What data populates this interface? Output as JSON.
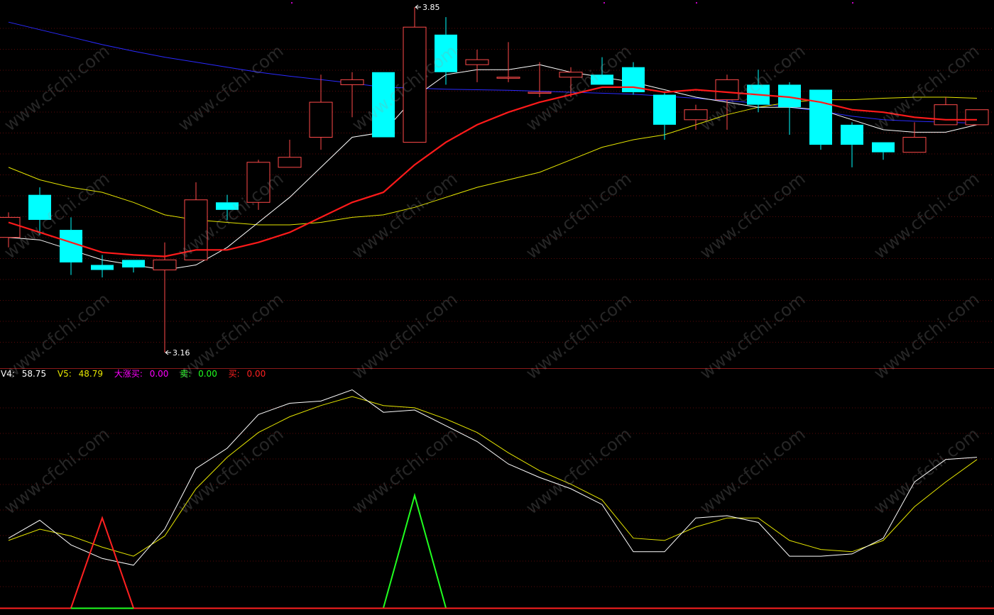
{
  "watermark": "www.cfchi.com",
  "colors": {
    "background": "#000000",
    "grid": "#5a0a0a",
    "separator": "#8b1a1a",
    "up_candle": "#ff4a4a",
    "down_candle": "#00ffff",
    "ma_white": "#ffffff",
    "ma_red": "#ff1a1a",
    "ma_yellow": "#e6e600",
    "ma_blue": "#2a2aff",
    "v4_line": "#ffffff",
    "v5_line": "#e6e600",
    "buy_line": "#ff2020",
    "sell_line": "#20ff20",
    "big_rise_line": "#ff00ff"
  },
  "legend": {
    "v4_label": "V4:",
    "v4_value": "58.75",
    "v5_label": "V5:",
    "v5_value": "48.79",
    "big_rise_label": "大涨买:",
    "big_rise_value": "0.00",
    "sell_label": "卖:",
    "sell_value": "0.00",
    "buy_label": "买:",
    "buy_value": "0.00"
  },
  "chart_data": [
    {
      "type": "candlestick",
      "title": "",
      "ylim": [
        3.14,
        3.86
      ],
      "annotations": [
        {
          "text": "3.85",
          "index": 13,
          "value": 3.85
        },
        {
          "text": "3.16",
          "index": 5,
          "value": 3.16
        }
      ],
      "candles": [
        {
          "open": 3.39,
          "close": 3.43,
          "high": 3.44,
          "low": 3.37
        },
        {
          "open": 3.475,
          "close": 3.425,
          "high": 3.49,
          "low": 3.395
        },
        {
          "open": 3.405,
          "close": 3.34,
          "high": 3.43,
          "low": 3.315
        },
        {
          "open": 3.335,
          "close": 3.325,
          "high": 3.355,
          "low": 3.31
        },
        {
          "open": 3.345,
          "close": 3.33,
          "high": 3.345,
          "low": 3.32
        },
        {
          "open": 3.325,
          "close": 3.345,
          "high": 3.38,
          "low": 3.16
        },
        {
          "open": 3.345,
          "close": 3.465,
          "high": 3.5,
          "low": 3.345
        },
        {
          "open": 3.46,
          "close": 3.445,
          "high": 3.475,
          "low": 3.425
        },
        {
          "open": 3.46,
          "close": 3.54,
          "high": 3.545,
          "low": 3.445
        },
        {
          "open": 3.53,
          "close": 3.55,
          "high": 3.585,
          "low": 3.53
        },
        {
          "open": 3.59,
          "close": 3.66,
          "high": 3.715,
          "low": 3.565
        },
        {
          "open": 3.695,
          "close": 3.705,
          "high": 3.72,
          "low": 3.63
        },
        {
          "open": 3.72,
          "close": 3.59,
          "high": 3.72,
          "low": 3.59
        },
        {
          "open": 3.58,
          "close": 3.81,
          "high": 3.85,
          "low": 3.58
        },
        {
          "open": 3.795,
          "close": 3.72,
          "high": 3.83,
          "low": 3.695
        },
        {
          "open": 3.735,
          "close": 3.745,
          "high": 3.765,
          "low": 3.7
        },
        {
          "open": 3.71,
          "close": 3.71,
          "high": 3.78,
          "low": 3.7
        },
        {
          "open": 3.68,
          "close": 3.68,
          "high": 3.74,
          "low": 3.67
        },
        {
          "open": 3.71,
          "close": 3.72,
          "high": 3.73,
          "low": 3.67
        },
        {
          "open": 3.715,
          "close": 3.695,
          "high": 3.75,
          "low": 3.695
        },
        {
          "open": 3.73,
          "close": 3.68,
          "high": 3.74,
          "low": 3.675
        },
        {
          "open": 3.675,
          "close": 3.615,
          "high": 3.68,
          "low": 3.585
        },
        {
          "open": 3.625,
          "close": 3.645,
          "high": 3.655,
          "low": 3.605
        },
        {
          "open": 3.665,
          "close": 3.705,
          "high": 3.715,
          "low": 3.605
        },
        {
          "open": 3.695,
          "close": 3.655,
          "high": 3.725,
          "low": 3.64
        },
        {
          "open": 3.695,
          "close": 3.65,
          "high": 3.7,
          "low": 3.595
        },
        {
          "open": 3.685,
          "close": 3.575,
          "high": 3.685,
          "low": 3.565
        },
        {
          "open": 3.615,
          "close": 3.575,
          "high": 3.62,
          "low": 3.53
        },
        {
          "open": 3.58,
          "close": 3.56,
          "high": 3.58,
          "low": 3.545
        },
        {
          "open": 3.56,
          "close": 3.59,
          "high": 3.62,
          "low": 3.56
        },
        {
          "open": 3.615,
          "close": 3.655,
          "high": 3.67,
          "low": 3.615
        },
        {
          "open": 3.615,
          "close": 3.645,
          "high": 3.645,
          "low": 3.615
        }
      ],
      "series": [
        {
          "color": "#ffffff",
          "values": [
            3.39,
            3.385,
            3.365,
            3.345,
            3.335,
            3.325,
            3.335,
            3.37,
            3.42,
            3.47,
            3.53,
            3.59,
            3.6,
            3.67,
            3.715,
            3.725,
            3.725,
            3.735,
            3.72,
            3.71,
            3.7,
            3.685,
            3.67,
            3.66,
            3.65,
            3.65,
            3.645,
            3.625,
            3.605,
            3.6,
            3.6,
            3.615
          ]
        },
        {
          "color": "#ff1a1a",
          "values": [
            3.42,
            3.4,
            3.38,
            3.36,
            3.355,
            3.352,
            3.365,
            3.365,
            3.38,
            3.4,
            3.43,
            3.46,
            3.48,
            3.535,
            3.58,
            3.615,
            3.64,
            3.66,
            3.675,
            3.69,
            3.69,
            3.68,
            3.685,
            3.68,
            3.675,
            3.67,
            3.66,
            3.645,
            3.64,
            3.63,
            3.625,
            3.625
          ]
        },
        {
          "color": "#e6e600",
          "values": [
            3.53,
            3.505,
            3.49,
            3.48,
            3.46,
            3.435,
            3.425,
            3.42,
            3.415,
            3.415,
            3.42,
            3.43,
            3.435,
            3.45,
            3.47,
            3.49,
            3.505,
            3.52,
            3.545,
            3.57,
            3.585,
            3.595,
            3.615,
            3.635,
            3.65,
            3.66,
            3.665,
            3.665,
            3.668,
            3.67,
            3.67,
            3.668
          ]
        },
        {
          "color": "#2a2aff",
          "values": [
            3.82,
            3.805,
            3.79,
            3.775,
            3.762,
            3.75,
            3.74,
            3.73,
            3.72,
            3.712,
            3.705,
            3.698,
            3.69,
            3.688,
            3.686,
            3.685,
            3.684,
            3.682,
            3.68,
            3.678,
            3.676,
            3.672,
            3.668,
            3.663,
            3.658,
            3.65,
            3.642,
            3.632,
            3.625,
            3.622,
            3.62,
            3.618
          ]
        }
      ]
    },
    {
      "type": "line",
      "title": "",
      "ylim": [
        0,
        100
      ],
      "x": [
        0,
        1,
        2,
        3,
        4,
        5,
        6,
        7,
        8,
        9,
        10,
        11,
        12,
        13,
        14,
        15,
        16,
        17,
        18,
        19,
        20,
        21,
        22,
        23,
        24,
        25,
        26,
        27,
        28,
        29,
        30,
        31
      ],
      "series": [
        {
          "name": "V4",
          "color": "#ffffff",
          "values": [
            31,
            39,
            28,
            22,
            19,
            35,
            62,
            71,
            86,
            91,
            92,
            97,
            87,
            88,
            81,
            74,
            64,
            58,
            53,
            46,
            25,
            25,
            40,
            41,
            38,
            23,
            23,
            24,
            31,
            56,
            66,
            67
          ]
        },
        {
          "name": "V5",
          "color": "#e6e600",
          "values": [
            30,
            35,
            32,
            27,
            23,
            32,
            53,
            67,
            78,
            85,
            90,
            94,
            90,
            89,
            84,
            78,
            69,
            61,
            55,
            48,
            31,
            30,
            36,
            40,
            40,
            30,
            26,
            25,
            30,
            45,
            56,
            66
          ]
        },
        {
          "name": "买",
          "color": "#ff2020",
          "values": [
            0,
            0,
            0,
            40,
            0,
            0,
            0,
            0,
            0,
            0,
            0,
            0,
            0,
            0,
            0,
            0,
            0,
            0,
            0,
            0,
            0,
            0,
            0,
            0,
            0,
            0,
            0,
            0,
            0,
            0,
            0,
            0
          ]
        },
        {
          "name": "卖",
          "color": "#20ff20",
          "values": [
            0,
            0,
            0,
            0,
            0,
            0,
            0,
            0,
            0,
            0,
            0,
            0,
            0,
            50,
            0,
            0,
            0,
            0,
            0,
            0,
            0,
            0,
            0,
            0,
            0,
            0,
            0,
            0,
            0,
            0,
            0,
            0
          ]
        }
      ]
    }
  ]
}
